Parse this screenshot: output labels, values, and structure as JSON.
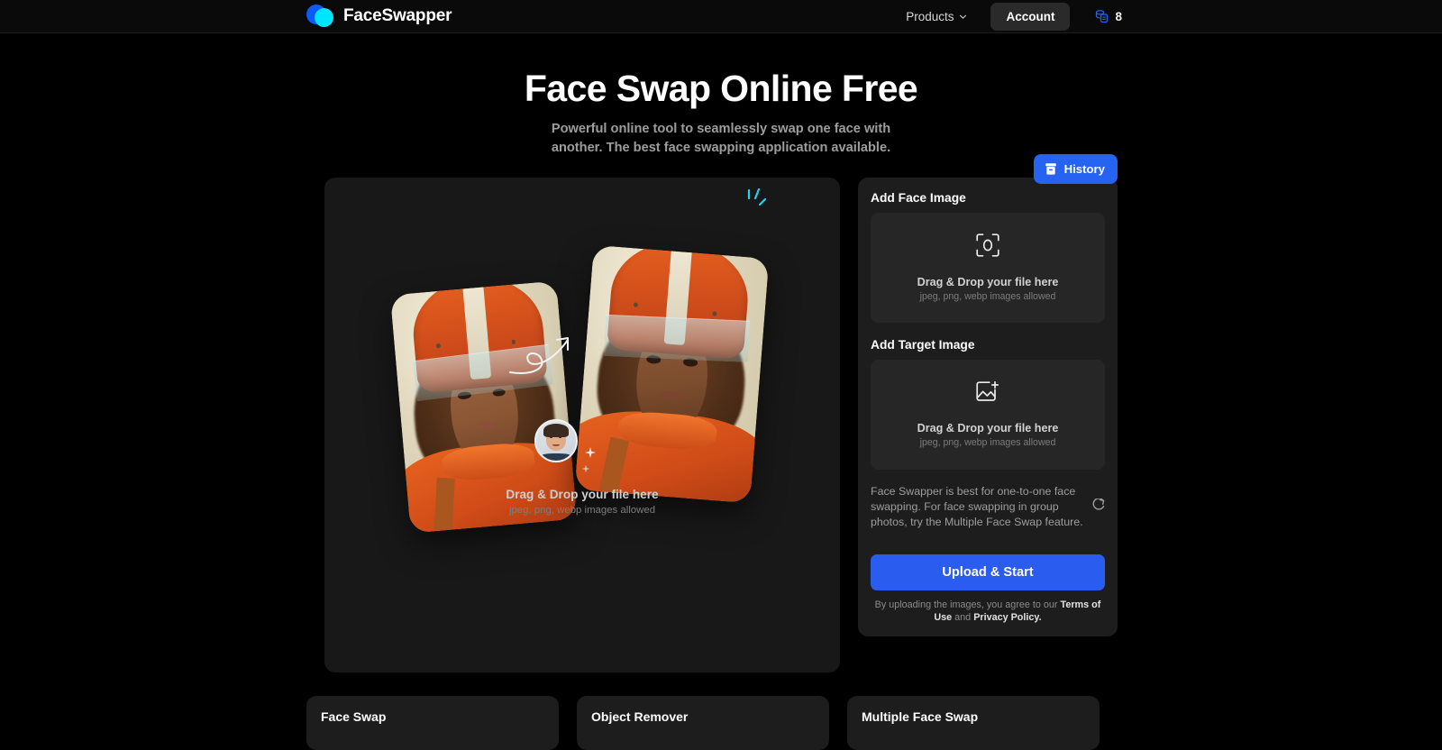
{
  "header": {
    "brand": "FaceSwapper",
    "logo_colors": {
      "primary": "#0b5cff",
      "secondary": "#00e5ff"
    },
    "nav": {
      "products_label": "Products",
      "chevron_icon": "chevron-down-icon"
    },
    "account_label": "Account",
    "credits": {
      "icon": "credits-coin-icon",
      "count": "8",
      "color": "#2563f0"
    }
  },
  "hero": {
    "title": "Face Swap Online Free",
    "subtitle": "Powerful online tool to seamlessly swap one face with another. The best face swapping application available."
  },
  "preview": {
    "drop_title": "Drag & Drop your file here",
    "drop_subtitle": "jpeg, png, webp images allowed",
    "illustration": {
      "source_image": "astronaut-woman-portrait",
      "result_image": "astronaut-face-swapped-portrait",
      "avatar": "male-face-avatar",
      "arrow": "curved-arrow-icon",
      "sparkles": [
        "sparkle-icon",
        "sparkle-icon",
        "sparkle-icon"
      ]
    }
  },
  "sidebar": {
    "history": {
      "label": "History",
      "icon": "history-archive-icon",
      "color": "#2563f0"
    },
    "face_section": {
      "label": "Add Face Image",
      "icon": "face-scan-icon",
      "drop_title": "Drag & Drop your file here",
      "drop_subtitle": "jpeg, png, webp images allowed"
    },
    "target_section": {
      "label": "Add Target Image",
      "icon": "image-plus-icon",
      "drop_title": "Drag & Drop your file here",
      "drop_subtitle": "jpeg, png, webp images allowed"
    },
    "hint": {
      "text": "Face Swapper is best for one-to-one face swapping. For face swapping in group photos, try the Multiple Face Swap feature.",
      "icon": "external-link-icon"
    },
    "cta": {
      "label": "Upload & Start",
      "color": "#2b5cf0"
    },
    "legal": {
      "prefix": "By uploading the images, you agree to our ",
      "terms": "Terms of Use",
      "middle": " and ",
      "privacy": "Privacy Policy."
    }
  },
  "feature_cards": [
    {
      "title": "Face Swap"
    },
    {
      "title": "Object Remover"
    },
    {
      "title": "Multiple Face Swap"
    }
  ]
}
